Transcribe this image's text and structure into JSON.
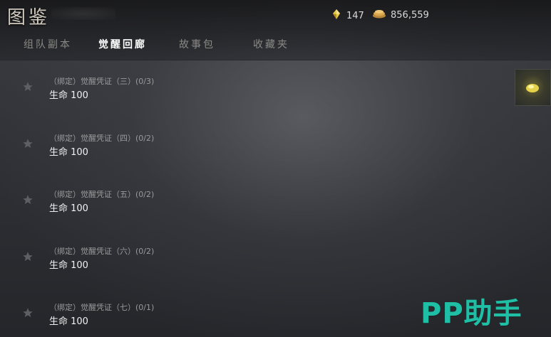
{
  "header": {
    "title": "图鉴",
    "currency": [
      {
        "icon": "diamond-icon",
        "value": "147"
      },
      {
        "icon": "coin-pile-icon",
        "value": "856,559"
      }
    ]
  },
  "tabs": [
    {
      "label": "组队副本",
      "active": false
    },
    {
      "label": "觉醒回廊",
      "active": true
    },
    {
      "label": "故事包",
      "active": false
    },
    {
      "label": "收藏夹",
      "active": false
    }
  ],
  "items": [
    {
      "title": "（绑定）觉醒凭证（三）(0/3)",
      "value": "生命 100"
    },
    {
      "title": "（绑定）觉醒凭证（四）(0/2)",
      "value": "生命 100"
    },
    {
      "title": "（绑定）觉醒凭证（五）(0/2)",
      "value": "生命 100"
    },
    {
      "title": "（绑定）觉醒凭证（六）(0/2)",
      "value": "生命 100"
    },
    {
      "title": "（绑定）觉醒凭证（七）(0/1)",
      "value": "生命 100"
    }
  ],
  "side_thumbnail": {
    "icon": "gold-item-icon"
  },
  "watermark": "PP助手",
  "colors": {
    "accent": "#1fbfa6",
    "active_tab": "#ffffff",
    "inactive_tab": "#8b8a86"
  }
}
